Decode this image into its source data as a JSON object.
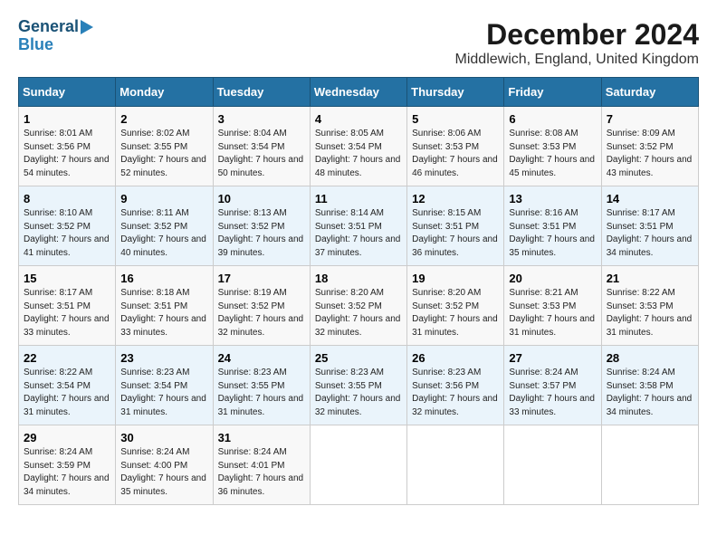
{
  "header": {
    "logo_line1": "General",
    "logo_line2": "Blue",
    "title": "December 2024",
    "subtitle": "Middlewich, England, United Kingdom"
  },
  "calendar": {
    "columns": [
      "Sunday",
      "Monday",
      "Tuesday",
      "Wednesday",
      "Thursday",
      "Friday",
      "Saturday"
    ],
    "weeks": [
      [
        null,
        null,
        null,
        null,
        null,
        null,
        null
      ]
    ]
  },
  "days": {
    "1": {
      "sunrise": "8:01 AM",
      "sunset": "3:56 PM",
      "daylight": "7 hours and 54 minutes."
    },
    "2": {
      "sunrise": "8:02 AM",
      "sunset": "3:55 PM",
      "daylight": "7 hours and 52 minutes."
    },
    "3": {
      "sunrise": "8:04 AM",
      "sunset": "3:54 PM",
      "daylight": "7 hours and 50 minutes."
    },
    "4": {
      "sunrise": "8:05 AM",
      "sunset": "3:54 PM",
      "daylight": "7 hours and 48 minutes."
    },
    "5": {
      "sunrise": "8:06 AM",
      "sunset": "3:53 PM",
      "daylight": "7 hours and 46 minutes."
    },
    "6": {
      "sunrise": "8:08 AM",
      "sunset": "3:53 PM",
      "daylight": "7 hours and 45 minutes."
    },
    "7": {
      "sunrise": "8:09 AM",
      "sunset": "3:52 PM",
      "daylight": "7 hours and 43 minutes."
    },
    "8": {
      "sunrise": "8:10 AM",
      "sunset": "3:52 PM",
      "daylight": "7 hours and 41 minutes."
    },
    "9": {
      "sunrise": "8:11 AM",
      "sunset": "3:52 PM",
      "daylight": "7 hours and 40 minutes."
    },
    "10": {
      "sunrise": "8:13 AM",
      "sunset": "3:52 PM",
      "daylight": "7 hours and 39 minutes."
    },
    "11": {
      "sunrise": "8:14 AM",
      "sunset": "3:51 PM",
      "daylight": "7 hours and 37 minutes."
    },
    "12": {
      "sunrise": "8:15 AM",
      "sunset": "3:51 PM",
      "daylight": "7 hours and 36 minutes."
    },
    "13": {
      "sunrise": "8:16 AM",
      "sunset": "3:51 PM",
      "daylight": "7 hours and 35 minutes."
    },
    "14": {
      "sunrise": "8:17 AM",
      "sunset": "3:51 PM",
      "daylight": "7 hours and 34 minutes."
    },
    "15": {
      "sunrise": "8:17 AM",
      "sunset": "3:51 PM",
      "daylight": "7 hours and 33 minutes."
    },
    "16": {
      "sunrise": "8:18 AM",
      "sunset": "3:51 PM",
      "daylight": "7 hours and 33 minutes."
    },
    "17": {
      "sunrise": "8:19 AM",
      "sunset": "3:52 PM",
      "daylight": "7 hours and 32 minutes."
    },
    "18": {
      "sunrise": "8:20 AM",
      "sunset": "3:52 PM",
      "daylight": "7 hours and 32 minutes."
    },
    "19": {
      "sunrise": "8:20 AM",
      "sunset": "3:52 PM",
      "daylight": "7 hours and 31 minutes."
    },
    "20": {
      "sunrise": "8:21 AM",
      "sunset": "3:53 PM",
      "daylight": "7 hours and 31 minutes."
    },
    "21": {
      "sunrise": "8:22 AM",
      "sunset": "3:53 PM",
      "daylight": "7 hours and 31 minutes."
    },
    "22": {
      "sunrise": "8:22 AM",
      "sunset": "3:54 PM",
      "daylight": "7 hours and 31 minutes."
    },
    "23": {
      "sunrise": "8:23 AM",
      "sunset": "3:54 PM",
      "daylight": "7 hours and 31 minutes."
    },
    "24": {
      "sunrise": "8:23 AM",
      "sunset": "3:55 PM",
      "daylight": "7 hours and 31 minutes."
    },
    "25": {
      "sunrise": "8:23 AM",
      "sunset": "3:55 PM",
      "daylight": "7 hours and 32 minutes."
    },
    "26": {
      "sunrise": "8:23 AM",
      "sunset": "3:56 PM",
      "daylight": "7 hours and 32 minutes."
    },
    "27": {
      "sunrise": "8:24 AM",
      "sunset": "3:57 PM",
      "daylight": "7 hours and 33 minutes."
    },
    "28": {
      "sunrise": "8:24 AM",
      "sunset": "3:58 PM",
      "daylight": "7 hours and 34 minutes."
    },
    "29": {
      "sunrise": "8:24 AM",
      "sunset": "3:59 PM",
      "daylight": "7 hours and 34 minutes."
    },
    "30": {
      "sunrise": "8:24 AM",
      "sunset": "4:00 PM",
      "daylight": "7 hours and 35 minutes."
    },
    "31": {
      "sunrise": "8:24 AM",
      "sunset": "4:01 PM",
      "daylight": "7 hours and 36 minutes."
    }
  }
}
